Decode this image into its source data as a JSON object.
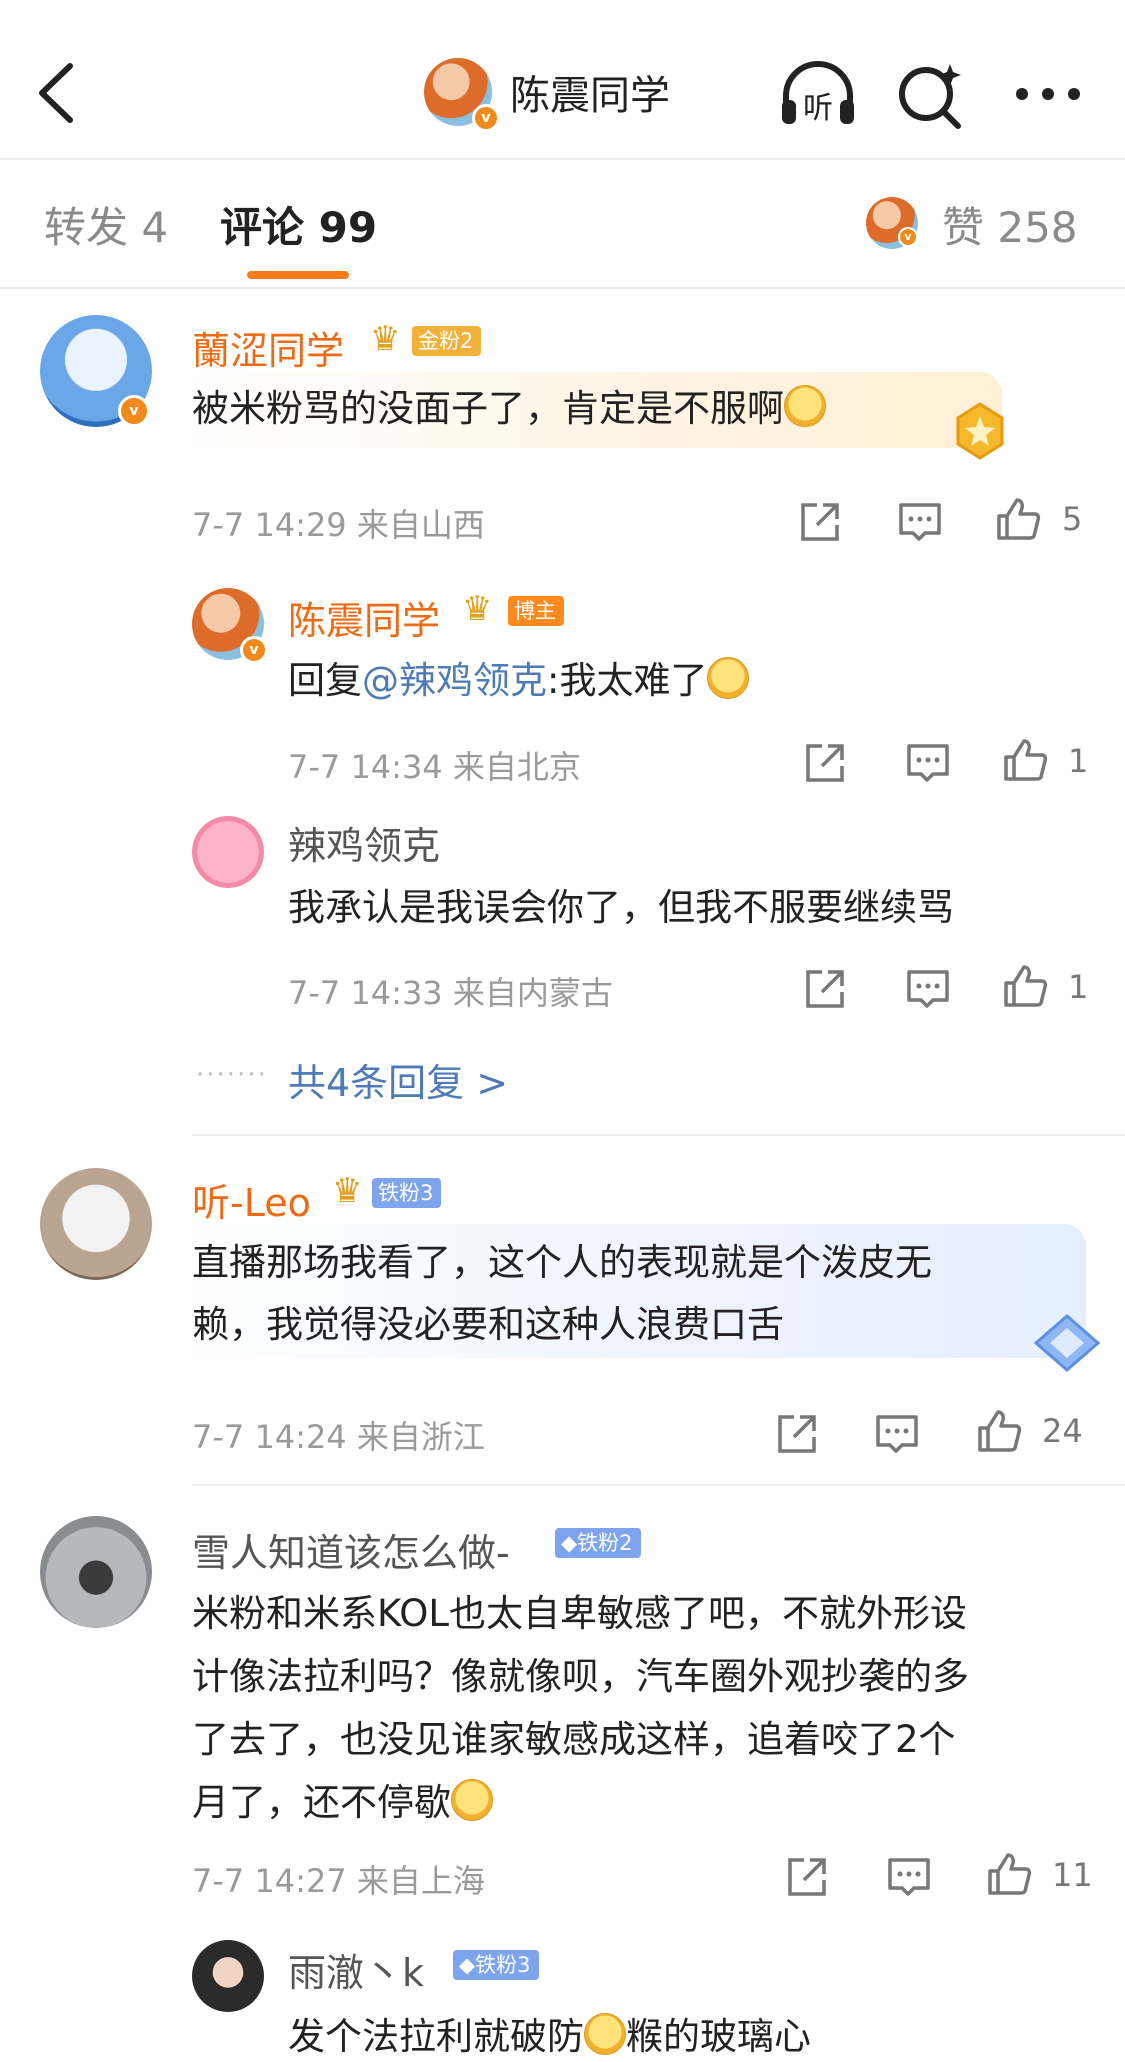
{
  "header": {
    "title": "陈震同学",
    "back_icon": "chevron-left-icon",
    "listen_label": "听",
    "icons": [
      "headphones-icon",
      "search-sparkle-icon",
      "more-icon"
    ]
  },
  "tabs": {
    "repost": "转发 4",
    "comment": "评论 99",
    "like": "赞 258"
  },
  "colors": {
    "accent": "#ff7a18",
    "name_orange": "#ef6a12",
    "mention_blue": "#4e7bb8"
  },
  "comments": [
    {
      "name": "蘭涩同学",
      "badge": "金粉2",
      "text": "被米粉骂的没面子了，肯定是不服啊",
      "time": "7-7 14:29",
      "location": "来自山西",
      "likes": "5",
      "replies": [
        {
          "name": "陈震同学",
          "badge": "博主",
          "reply_prefix": "回复",
          "mention": "@辣鸡领克",
          "text": ":我太难了",
          "time": "7-7 14:34",
          "location": "来自北京",
          "likes": "1"
        },
        {
          "name": "辣鸡领克",
          "text": "我承认是我误会你了，但我不服要继续骂",
          "time": "7-7 14:33",
          "location": "来自内蒙古",
          "likes": "1"
        }
      ],
      "more_replies": "共4条回复 >"
    },
    {
      "name": "听-Leo",
      "badge": "铁粉3",
      "text_line1": "直播那场我看了，这个人的表现就是个泼皮无",
      "text_line2": "赖，我觉得没必要和这种人浪费口舌",
      "time": "7-7 14:24",
      "location": "来自浙江",
      "likes": "24"
    },
    {
      "name": "雪人知道该怎么做-",
      "badge": "铁粉2",
      "text_line1": "米粉和米系KOL也太自卑敏感了吧，不就外形设",
      "text_line2": "计像法拉利吗？像就像呗，汽车圈外观抄袭的多",
      "text_line3": "了去了，也没见谁家敏感成这样，追着咬了2个",
      "text_line4": "月了，还不停歇",
      "time": "7-7 14:27",
      "location": "来自上海",
      "likes": "11",
      "replies": [
        {
          "name": "雨澈丶k",
          "badge": "铁粉3",
          "text_a": "发个法拉利就破防",
          "text_b": "糇的玻璃心"
        }
      ]
    }
  ]
}
